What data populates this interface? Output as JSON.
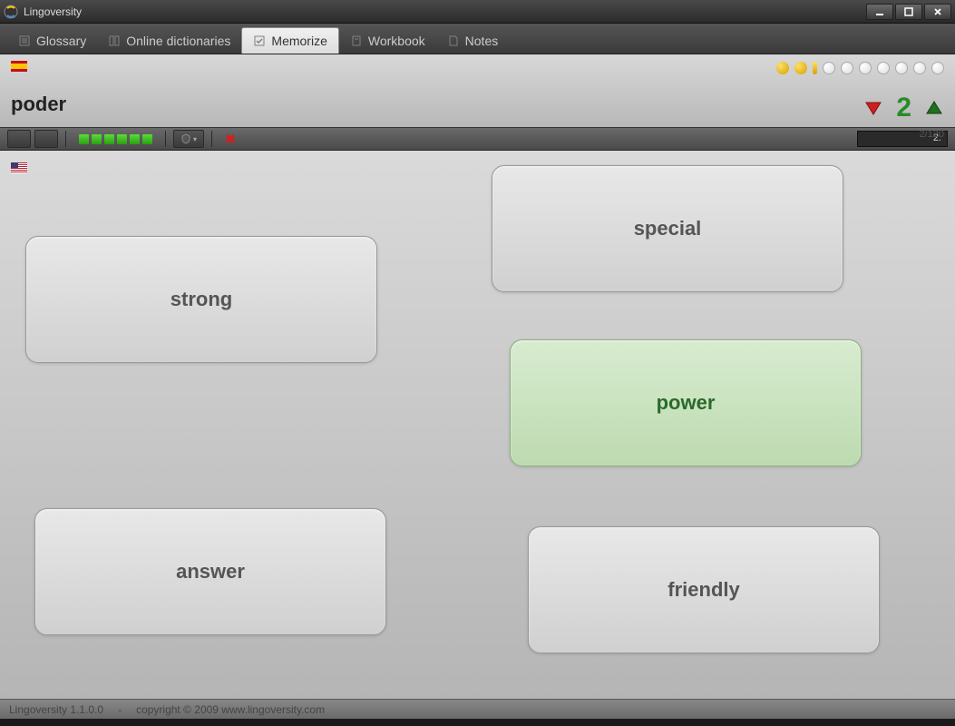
{
  "app": {
    "title": "Lingoversity"
  },
  "tabs": [
    {
      "label": "Glossary"
    },
    {
      "label": "Online dictionaries"
    },
    {
      "label": "Memorize",
      "active": true
    },
    {
      "label": "Workbook"
    },
    {
      "label": "Notes"
    }
  ],
  "question": {
    "lang": "es",
    "word": "poder"
  },
  "progress": {
    "dots_gold": 2,
    "dots_half": 1,
    "dots_white": 7,
    "score": "2",
    "counter": "2/120",
    "toolbar_counter": "2."
  },
  "green_squares": 6,
  "answer_lang": "us",
  "answers": [
    {
      "label": "strong",
      "correct": false
    },
    {
      "label": "special",
      "correct": false
    },
    {
      "label": "power",
      "correct": true
    },
    {
      "label": "answer",
      "correct": false
    },
    {
      "label": "friendly",
      "correct": false
    }
  ],
  "statusbar": {
    "version": "Lingoversity 1.1.0.0",
    "sep": "-",
    "copyright": "copyright © 2009 www.lingoversity.com"
  }
}
